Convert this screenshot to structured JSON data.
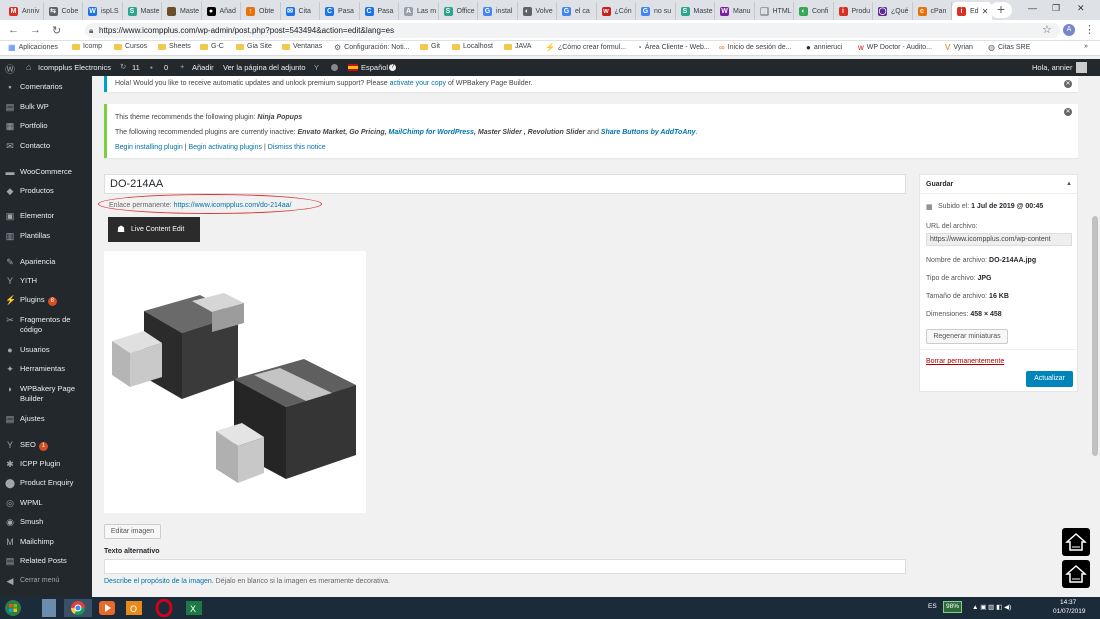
{
  "browser": {
    "tabs": [
      {
        "label": "Anniv",
        "fav": "#d93025",
        "fav_text": "M"
      },
      {
        "label": "Cobe",
        "fav": "#5f6368",
        "fav_text": "⇆"
      },
      {
        "label": "ispLS",
        "fav": "#1a73e8",
        "fav_text": "W"
      },
      {
        "label": "Maste",
        "fav": "#2ca58d",
        "fav_text": "S"
      },
      {
        "label": "Maste",
        "fav": "#6b4f2a",
        "fav_text": ""
      },
      {
        "label": "Añad",
        "fav": "#000000",
        "fav_text": "●"
      },
      {
        "label": "Obte",
        "fav": "#e8710a",
        "fav_text": "↑"
      },
      {
        "label": "Cita",
        "fav": "#1a73e8",
        "fav_text": "✉"
      },
      {
        "label": "Pasa",
        "fav": "#1a73e8",
        "fav_text": "C"
      },
      {
        "label": "Pasa",
        "fav": "#1a73e8",
        "fav_text": "C"
      },
      {
        "label": "Las m",
        "fav": "#9aa0a6",
        "fav_text": "A"
      },
      {
        "label": "Office",
        "fav": "#2ca58d",
        "fav_text": "S"
      },
      {
        "label": "instal",
        "fav": "#4285f4",
        "fav_text": "G"
      },
      {
        "label": "Volve",
        "fav": "#5f6368",
        "fav_text": "◐"
      },
      {
        "label": "el ca",
        "fav": "#4285f4",
        "fav_text": "G"
      },
      {
        "label": "¿Cón",
        "fav": "#c5221f",
        "fav_text": "w"
      },
      {
        "label": "no su",
        "fav": "#4285f4",
        "fav_text": "G"
      },
      {
        "label": "Maste",
        "fav": "#2ca58d",
        "fav_text": "S"
      },
      {
        "label": "Manu",
        "fav": "#7b1fa2",
        "fav_text": "W"
      },
      {
        "label": "HTML",
        "fav": "#9aa0a6",
        "fav_text": "▤"
      },
      {
        "label": "Confi",
        "fav": "#34a853",
        "fav_text": "◐"
      },
      {
        "label": "Produ",
        "fav": "#d93025",
        "fav_text": "i"
      },
      {
        "label": "¿Qué",
        "fav": "#5f2a8f",
        "fav_text": "◯"
      },
      {
        "label": "cPan",
        "fav": "#e8710a",
        "fav_text": "c"
      },
      {
        "label": "Ed",
        "fav": "#d93025",
        "fav_text": "i",
        "active": true
      }
    ],
    "url": "https://www.icompplus.com/wp-admin/post.php?post=543494&action=edit&lang=es",
    "bookmarks": [
      {
        "label": "Aplicaciones",
        "type": "apps"
      },
      {
        "label": "Icomp",
        "type": "folder"
      },
      {
        "label": "Cursos",
        "type": "folder"
      },
      {
        "label": "Sheets",
        "type": "folder"
      },
      {
        "label": "G-C",
        "type": "folder"
      },
      {
        "label": "Gia Site",
        "type": "folder"
      },
      {
        "label": "Ventanas",
        "type": "folder"
      },
      {
        "label": "Configuración: Noti...",
        "type": "gear"
      },
      {
        "label": "Git",
        "type": "folder"
      },
      {
        "label": "Localhost",
        "type": "folder"
      },
      {
        "label": "JAVA",
        "type": "folder"
      },
      {
        "label": "¿Cómo crear formul...",
        "type": "bolt"
      },
      {
        "label": "Área Cliente - Web...",
        "type": "circle"
      },
      {
        "label": "Inicio de sesión de...",
        "type": "cp"
      },
      {
        "label": "annieruci",
        "type": "github"
      },
      {
        "label": "WP Doctor - Audito...",
        "type": "w"
      },
      {
        "label": "Vyrian",
        "type": "v"
      },
      {
        "label": "Citas SRE",
        "type": "globe"
      }
    ]
  },
  "adminbar": {
    "site": "Icompplus Electronics",
    "updates": "11",
    "comments": "0",
    "add_new": "Añadir",
    "view": "Ver la página del adjunto",
    "language": "Español",
    "greeting": "Hola, annier"
  },
  "sidebar": {
    "items": [
      {
        "label": "Comentarios",
        "icon": "comment-icon",
        "glyph": "▪"
      },
      {
        "label": "Bulk WP",
        "icon": "bulk-icon",
        "glyph": "▤"
      },
      {
        "label": "Portfolio",
        "icon": "portfolio-icon",
        "glyph": "▦"
      },
      {
        "label": "Contacto",
        "icon": "mail-icon",
        "glyph": "✉"
      },
      {
        "label": "WooCommerce",
        "icon": "woo-icon",
        "glyph": "▬"
      },
      {
        "label": "Productos",
        "icon": "products-icon",
        "glyph": "◆"
      },
      {
        "label": "Elementor",
        "icon": "elementor-icon",
        "glyph": "▣"
      },
      {
        "label": "Plantillas",
        "icon": "templates-icon",
        "glyph": "▥"
      },
      {
        "label": "Apariencia",
        "icon": "appearance-icon",
        "glyph": "✎"
      },
      {
        "label": "YITH",
        "icon": "yith-icon",
        "glyph": "Y"
      },
      {
        "label": "Plugins",
        "icon": "plugins-icon",
        "glyph": "⚡",
        "badge": "8"
      },
      {
        "label": "Fragmentos de código",
        "icon": "snippets-icon",
        "glyph": "✂"
      },
      {
        "label": "Usuarios",
        "icon": "users-icon",
        "glyph": "●"
      },
      {
        "label": "Herramientas",
        "icon": "tools-icon",
        "glyph": "✦"
      },
      {
        "label": "WPBakery Page Builder",
        "icon": "wpbakery-icon",
        "glyph": "◗"
      },
      {
        "label": "Ajustes",
        "icon": "settings-icon",
        "glyph": "▤"
      },
      {
        "label": "SEO",
        "icon": "seo-icon",
        "glyph": "Y",
        "badge": "1"
      },
      {
        "label": "ICPP Plugin",
        "icon": "icpp-icon",
        "glyph": "✱"
      },
      {
        "label": "Product Enquiry",
        "icon": "enquiry-icon",
        "glyph": "⬤"
      },
      {
        "label": "WPML",
        "icon": "wpml-icon",
        "glyph": "◎"
      },
      {
        "label": "Smush",
        "icon": "smush-icon",
        "glyph": "◉"
      },
      {
        "label": "Mailchimp",
        "icon": "mailchimp-icon",
        "glyph": "M"
      },
      {
        "label": "Related Posts",
        "icon": "related-icon",
        "glyph": "▤"
      },
      {
        "label": "Cerrar menú",
        "icon": "collapse-icon",
        "glyph": "◀"
      }
    ]
  },
  "notices": {
    "support": {
      "text": "Hola! Would you like to receive automatic updates and unlock premium support? Please ",
      "link": "activate your copy",
      "after": " of WPBakery Page Builder."
    },
    "theme": {
      "line1_prefix": "This theme recommends the following plugin: ",
      "line1_plugin": "Ninja Popups",
      "line2_prefix": "The following recommended plugins are currently inactive: ",
      "line2_a": "Envato Market, Go Pricing, ",
      "line2_link1": "MailChimp for WordPress",
      "line2_b": ", Master Slider , Revolution Slider",
      "line2_and": " and ",
      "line2_link2": "Share Buttons by AddToAny",
      "link_install": "Begin installing plugin",
      "link_activate": "Begin activating plugins",
      "link_dismiss": "Dismiss this notice"
    }
  },
  "editor": {
    "title": "DO-214AA",
    "permalink_label": "Enlace permanente: ",
    "permalink_url": "https://www.icompplus.com/do-214aa/",
    "live_edit": "Live Content Edit",
    "edit_image": "Editar imagen",
    "alt_label": "Texto alternativo",
    "alt_help_link": "Describe el propósito de la imagen",
    "alt_help_text": ". Déjalo en blanco si la imagen es meramente decorativa."
  },
  "savebox": {
    "heading": "Guardar",
    "uploaded_label": "Subido el: ",
    "uploaded_value": "1 Jul de 2019 @ 00:45",
    "url_label": "URL del archivo:",
    "url_value": "https://www.icompplus.com/wp-content",
    "filename_label": "Nombre de archivo: ",
    "filename_value": "DO-214AA.jpg",
    "filetype_label": "Tipo de archivo: ",
    "filetype_value": "JPG",
    "filesize_label": "Tamaño de archivo: ",
    "filesize_value": "16 KB",
    "dims_label": "Dimensiones: ",
    "dims_value": "458 × 458",
    "regen": "Regenerar miniaturas",
    "delete": "Borrar permanentemente",
    "update": "Actualizar"
  },
  "taskbar": {
    "lang": "ES",
    "battery": "98%",
    "time": "14:37",
    "date": "01/07/2019"
  }
}
